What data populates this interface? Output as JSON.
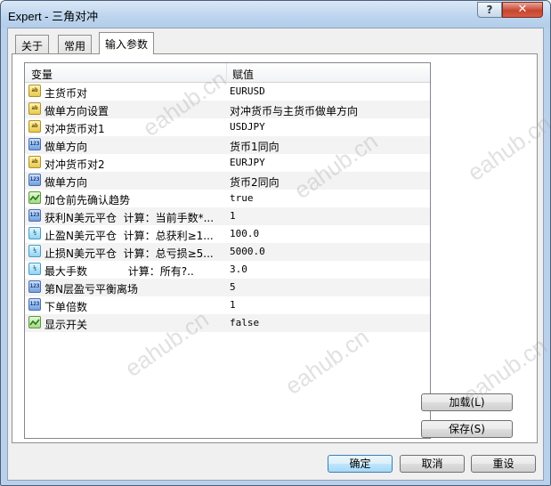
{
  "window": {
    "title": "Expert - 三角对冲",
    "help_label": "?",
    "close_label": "✕"
  },
  "tabs": [
    {
      "label": "关于"
    },
    {
      "label": "常用"
    },
    {
      "label": "输入参数"
    }
  ],
  "table": {
    "col_variable": "变量",
    "col_value": "赋值",
    "rows": [
      {
        "type": "string",
        "type_icon": "ab",
        "name": "主货币对",
        "value": "EURUSD"
      },
      {
        "type": "string",
        "type_icon": "ab",
        "name": "做单方向设置",
        "value": "对冲货币与主货币做单方向"
      },
      {
        "type": "string",
        "type_icon": "ab",
        "name": "对冲货币对1",
        "value": "USDJPY"
      },
      {
        "type": "int",
        "type_icon": "123",
        "name": "做单方向",
        "value": "货币1同向"
      },
      {
        "type": "string",
        "type_icon": "ab",
        "name": "对冲货币对2",
        "value": "EURJPY"
      },
      {
        "type": "int",
        "type_icon": "123",
        "name": "做单方向",
        "value": "货币2同向"
      },
      {
        "type": "bool",
        "type_icon": "bool",
        "name": "加仓前先确认趋势",
        "value": "true"
      },
      {
        "type": "int",
        "type_icon": "123",
        "name": "获利N美元平仓  计算：当前手数*...",
        "value": "1"
      },
      {
        "type": "double",
        "type_icon": "½",
        "name": "止盈N美元平仓  计算：总获利≥1...",
        "value": "100.0"
      },
      {
        "type": "double",
        "type_icon": "½",
        "name": "止损N美元平仓  计算：总亏损≥5...",
        "value": "5000.0"
      },
      {
        "type": "double",
        "type_icon": "½",
        "name": "最大手数            计算：所有?..",
        "value": "3.0"
      },
      {
        "type": "int",
        "type_icon": "123",
        "name": "第N层盈亏平衡离场",
        "value": "5"
      },
      {
        "type": "int",
        "type_icon": "123",
        "name": "下单倍数",
        "value": "1"
      },
      {
        "type": "bool",
        "type_icon": "bool",
        "name": "显示开关",
        "value": "false"
      }
    ]
  },
  "side_buttons": {
    "load": "加载(L)",
    "save": "保存(S)"
  },
  "bottom_buttons": {
    "ok": "确定",
    "cancel": "取消",
    "reset": "重设"
  },
  "watermark": "eahub.cn",
  "colors": {
    "titlebar": "#bcd4ee",
    "close": "#c7452f",
    "alt_row": "#f3f3f3"
  }
}
